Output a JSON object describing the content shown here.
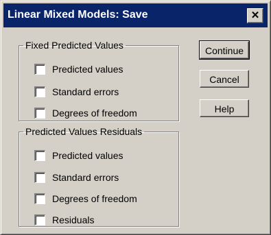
{
  "window": {
    "title": "Linear Mixed Models: Save",
    "close_label": "✕"
  },
  "fixed_group": {
    "legend": "Fixed Predicted Values",
    "items": [
      {
        "label": "Predicted values",
        "checked": false
      },
      {
        "label": "Standard errors",
        "checked": false
      },
      {
        "label": "Degrees of freedom",
        "checked": false
      }
    ]
  },
  "residual_group": {
    "legend": "Predicted Values  Residuals",
    "items": [
      {
        "label": "Predicted values",
        "checked": false
      },
      {
        "label": "Standard errors",
        "checked": false
      },
      {
        "label": "Degrees of freedom",
        "checked": false
      },
      {
        "label": "Residuals",
        "checked": false
      }
    ]
  },
  "buttons": {
    "continue_label": "Continue",
    "cancel_label": "Cancel",
    "help_label": "Help"
  },
  "colors": {
    "titlebar": "#0a246a",
    "dialog_face": "#d4d0c8"
  }
}
